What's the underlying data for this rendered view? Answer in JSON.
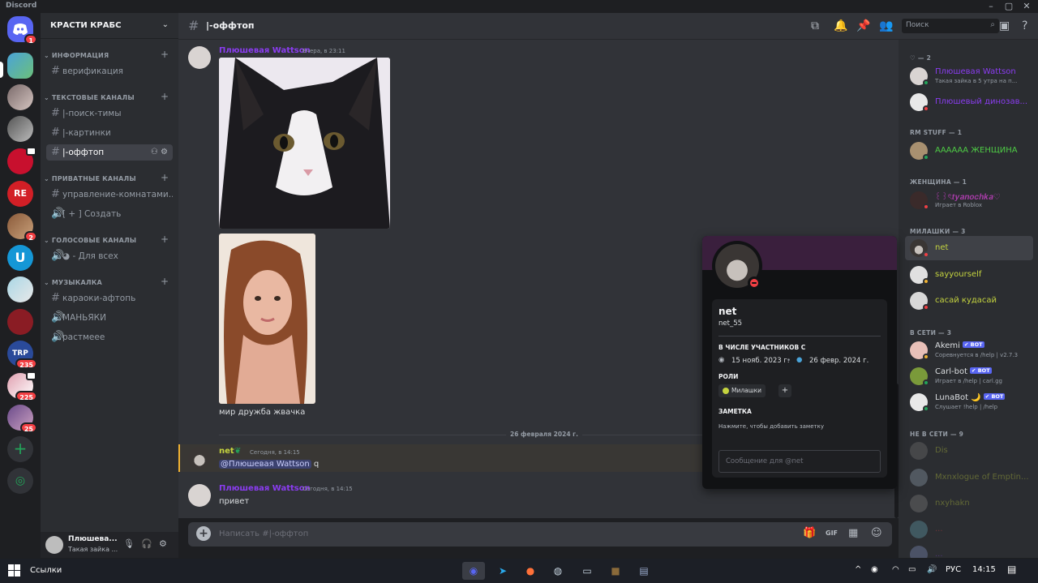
{
  "window": {
    "title": "Discord"
  },
  "guild": {
    "name": "КРАСТИ КРАБС"
  },
  "rail": {
    "home_badge": "1",
    "badges": [
      "2",
      "235",
      "225",
      "25"
    ]
  },
  "categories": [
    {
      "label": "ИНФОРМАЦИЯ"
    },
    {
      "label": "ТЕКСТОВЫЕ КАНАЛЫ"
    },
    {
      "label": "ПРИВАТНЫЕ КАНАЛЫ"
    },
    {
      "label": "ГОЛОСОВЫЕ КАНАЛЫ"
    },
    {
      "label": "МУЗЫКАЛКА"
    }
  ],
  "channels": [
    {
      "label": "верификация"
    },
    {
      "label": "|-поиск-тимы"
    },
    {
      "label": "|-картинки"
    },
    {
      "label": "|-оффтоп"
    },
    {
      "label": "управление-комнатами..."
    },
    {
      "label": "[ + ] Создать"
    },
    {
      "label": "◕ - Для всех"
    },
    {
      "label": "караоки-афтопь"
    },
    {
      "label": "МАНЬЯКИ"
    },
    {
      "label": "растмеее"
    }
  ],
  "user_panel": {
    "name": "Плюшева...",
    "status": "Такая зайка ..."
  },
  "channel_header": {
    "title": "|-оффтоп",
    "search_placeholder": "Поиск"
  },
  "messages": [
    {
      "author": "Плюшевая Wattson",
      "time": "Вчера, в 23:11",
      "caption": "мир дружба жвачка"
    },
    {
      "author": "net",
      "time": "Сегодня, в 14:15",
      "mention": "@Плюшевая Wattson",
      "text": " q"
    },
    {
      "author": "Плюшевая Wattson",
      "time": "Сегодня, в 14:15",
      "text": "привет"
    }
  ],
  "date_divider": "26 февраля 2024 г.",
  "composer": {
    "placeholder": "Написать #|-оффтоп"
  },
  "member_groups": [
    {
      "label": "♡ — 2"
    },
    {
      "label": "RM STUFF — 1"
    },
    {
      "label": "ЖЕНЩИНА — 1"
    },
    {
      "label": "МИЛАШКИ — 3"
    },
    {
      "label": "В СЕТИ — 3"
    },
    {
      "label": "НЕ В СЕТИ — 9"
    }
  ],
  "members": [
    {
      "name": "Плюшевая Wattson",
      "status": "Такая зайка в 5 утра на п...",
      "color": "#8a3cf0"
    },
    {
      "name": "Плюшевый динозав...",
      "color": "#8a3cf0"
    },
    {
      "name": "АААААА ЖЕНЩИНА",
      "color": "#4ecb45"
    },
    {
      "name": "꒰꒱ৎ𝒕𝒚𝒂𝒏𝒐𝒄𝒉𝒌𝒂♡",
      "status": "Играет в Roblox",
      "color": "#a83ca8"
    },
    {
      "name": "net",
      "color": "#c5d43f"
    },
    {
      "name": "sayyourself",
      "color": "#c5d43f"
    },
    {
      "name": "сасай кудасай",
      "color": "#c5d43f"
    },
    {
      "name": "Akemi",
      "status": "Соревнуется в /help | v2.7.3",
      "bot": "✔ BOT"
    },
    {
      "name": "Carl-bot",
      "status": "Играет в /help | carl.gg",
      "bot": "✔ BOT"
    },
    {
      "name": "LunaBot 🌙",
      "status": "Слушает !help | /help",
      "bot": "✔ BOT"
    },
    {
      "name": "Dis"
    },
    {
      "name": "Mxnxlogue of Emptin..."
    },
    {
      "name": "nxyhakn"
    },
    {
      "name": "..."
    },
    {
      "name": "..."
    }
  ],
  "profile": {
    "display_name": "net",
    "username": "net_55",
    "member_since_label": "В ЧИСЛЕ УЧАСТНИКОВ С",
    "discord_date": "15 нояб. 2023 г.",
    "server_date": "26 февр. 2024 г.",
    "roles_label": "РОЛИ",
    "role": "Милашки",
    "note_label": "ЗАМЕТКА",
    "note_placeholder": "Нажмите, чтобы добавить заметку",
    "message_placeholder": "Сообщение для @net"
  },
  "taskbar": {
    "search_label": "Ссылки",
    "lang": "РУС",
    "time": "14:15"
  },
  "colors": {
    "accent": "#5865f2",
    "dnd": "#f23f43",
    "online": "#23a55a",
    "mention_bar": "#f0b232"
  }
}
